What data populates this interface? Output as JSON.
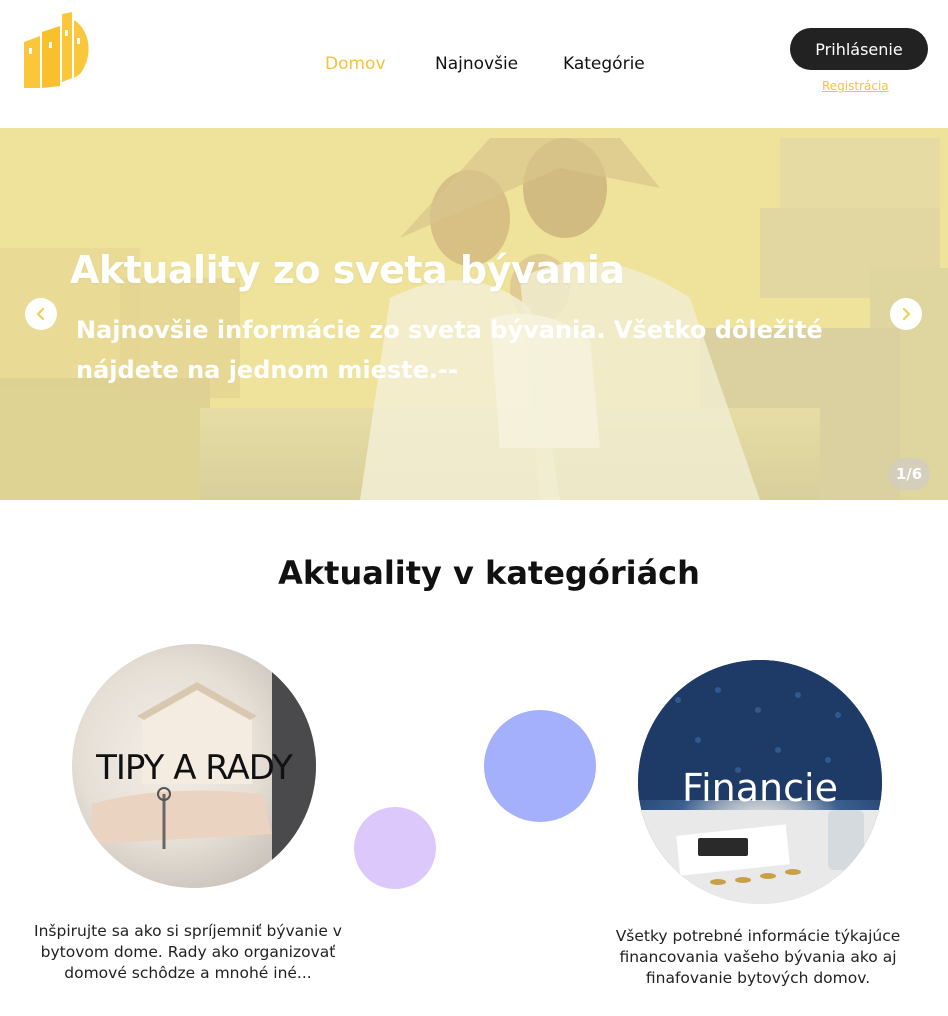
{
  "header": {
    "nav": {
      "home": "Domov",
      "newest": "Najnovšie",
      "categories": "Kategórie"
    },
    "login_label": "Prihlásenie",
    "register_label": "Registrácia",
    "accent_color": "#f7c23b"
  },
  "hero": {
    "title": "Aktuality zo sveta bývania",
    "subtitle": "Najnovšie informácie zo sveta bývania. Všetko dôležité nájdete na jednom mieste.--",
    "counter": "1/6"
  },
  "categories": {
    "title": "Aktuality v kategóriách",
    "items": [
      {
        "label": "TIPY A RADY",
        "description": "Inšpirujte sa ako si spríjemniť bývanie v bytovom dome. Rady ako organizovať domové schôdze a mnohé iné..."
      },
      {
        "label": "Financie",
        "description": "Všetky potrebné informácie týkajúce financovania vašeho bývania ako aj finafovanie bytových domov."
      }
    ],
    "decor_colors": [
      "#dcc8fb",
      "#a4b0fb"
    ]
  }
}
